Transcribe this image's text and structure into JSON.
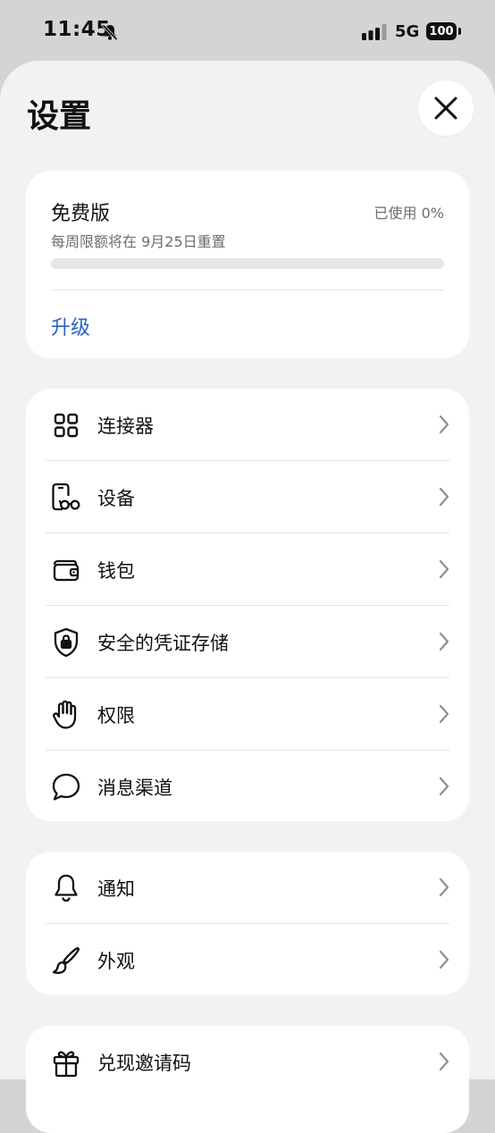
{
  "status_bar": {
    "time": "11:45",
    "network": "5G",
    "battery": "100"
  },
  "header": {
    "title": "设置"
  },
  "plan": {
    "name": "免费版",
    "usage": "已使用 0%",
    "usage_fraction": 0,
    "reset_note": "每周限额将在 9月25日重置",
    "upgrade_label": "升级"
  },
  "groups": [
    {
      "items": [
        {
          "label": "连接器",
          "icon": "grid-icon"
        },
        {
          "label": "设备",
          "icon": "phone-glasses-icon"
        },
        {
          "label": "钱包",
          "icon": "wallet-icon"
        },
        {
          "label": "安全的凭证存储",
          "icon": "shield-lock-icon"
        },
        {
          "label": "权限",
          "icon": "hand-icon"
        },
        {
          "label": "消息渠道",
          "icon": "chat-bubble-icon"
        }
      ]
    },
    {
      "items": [
        {
          "label": "通知",
          "icon": "bell-icon"
        },
        {
          "label": "外观",
          "icon": "paintbrush-icon"
        }
      ]
    },
    {
      "items": [
        {
          "label": "兑现邀请码",
          "icon": "gift-icon"
        }
      ]
    }
  ]
}
